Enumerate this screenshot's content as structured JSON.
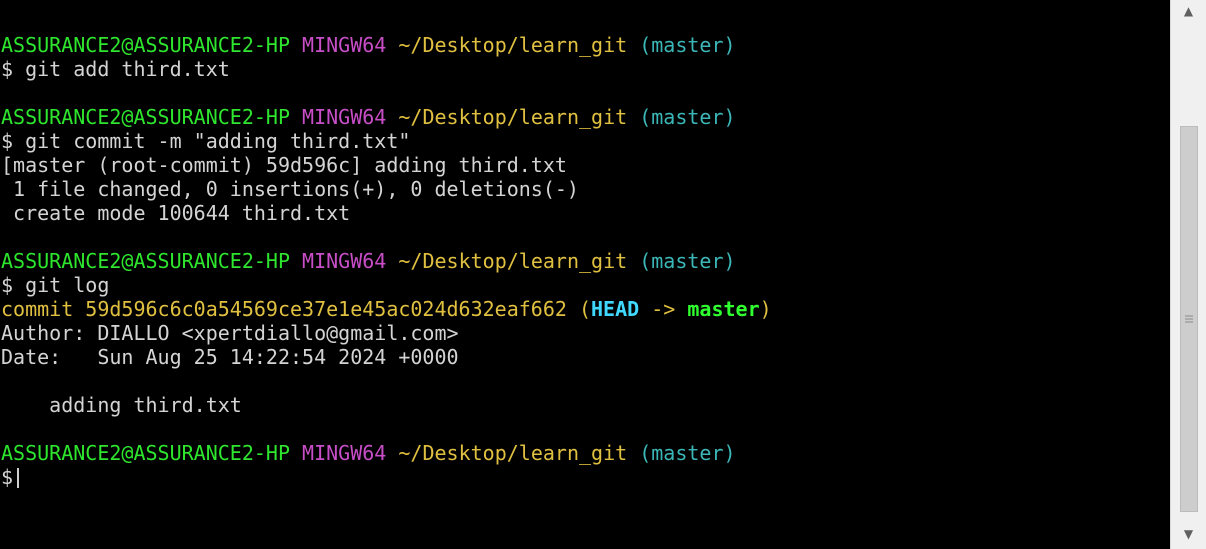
{
  "prompt": {
    "user": "ASSURANCE2@ASSURANCE2-HP",
    "host": "MINGW64",
    "path": "~/Desktop/learn_git",
    "branch": "(master)",
    "symbol": "$"
  },
  "commands": {
    "add": "git add third.txt",
    "commit": "git commit -m \"adding third.txt\"",
    "log": "git log"
  },
  "commit_output": {
    "line1": "[master (root-commit) 59d596c] adding third.txt",
    "line2": " 1 file changed, 0 insertions(+), 0 deletions(-)",
    "line3": " create mode 100644 third.txt"
  },
  "log_output": {
    "commit_prefix": "commit 59d596c6c0a54569ce37e1e45ac024d632eaf662 ",
    "paren_open": "(",
    "head": "HEAD",
    "arrow": " -> ",
    "master": "master",
    "paren_close": ")",
    "author": "Author: DIALLO <xpertdiallo@gmail.com>",
    "date": "Date:   Sun Aug 25 14:22:54 2024 +0000",
    "message": "    adding third.txt"
  },
  "scrollbar": {
    "up_arrow": "▲",
    "down_arrow": "▼"
  },
  "colors": {
    "background": "#000000",
    "user": "#2ee62e",
    "host": "#c84ec8",
    "path": "#e0c040",
    "branch": "#3cb7b7"
  }
}
